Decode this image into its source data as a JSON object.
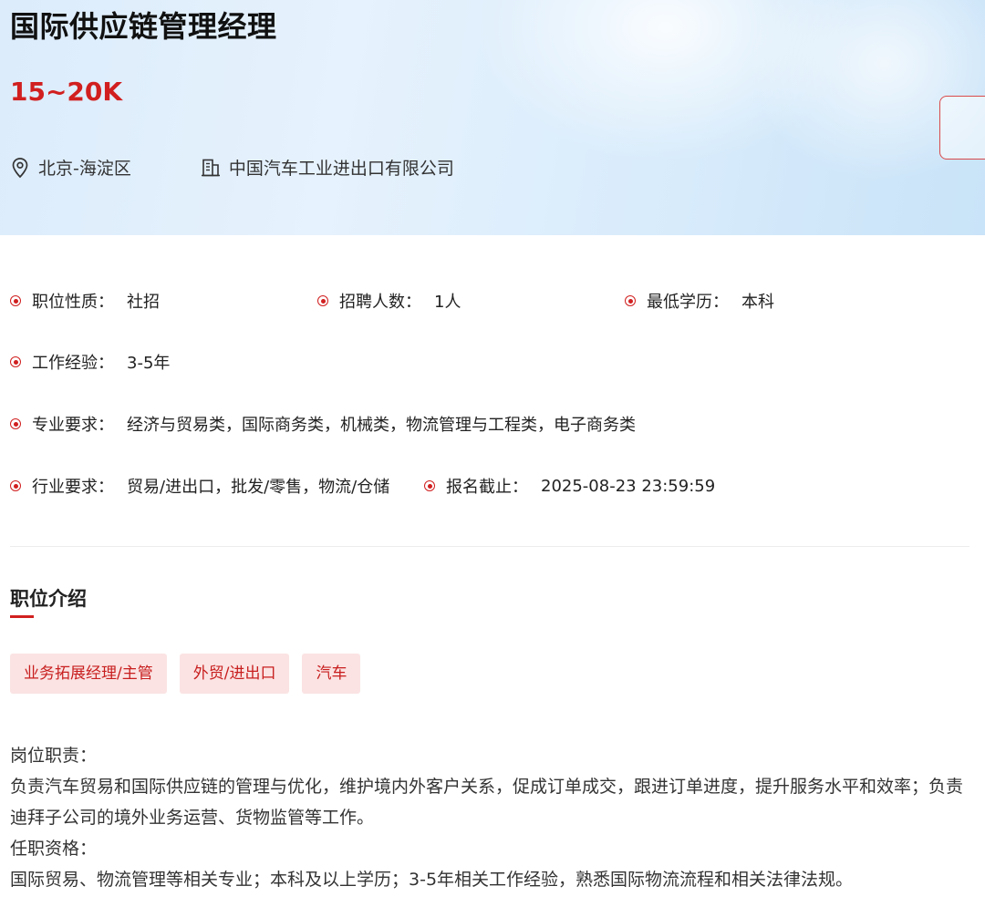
{
  "job": {
    "title": "国际供应链管理经理",
    "salary": "15~20K",
    "location": "北京-海淀区",
    "company": "中国汽车工业进出口有限公司"
  },
  "info": {
    "nature_label": "职位性质：",
    "nature_value": "社招",
    "headcount_label": "招聘人数：",
    "headcount_value": "1人",
    "education_label": "最低学历：",
    "education_value": "本科",
    "experience_label": "工作经验：",
    "experience_value": "3-5年",
    "major_label": "专业要求：",
    "major_value": "经济与贸易类，国际商务类，机械类，物流管理与工程类，电子商务类",
    "industry_label": "行业要求：",
    "industry_value": "贸易/进出口，批发/零售，物流/仓储",
    "deadline_label": "报名截止：",
    "deadline_value": "2025-08-23 23:59:59"
  },
  "section": {
    "title": "职位介绍"
  },
  "tags": [
    "业务拓展经理/主管",
    "外贸/进出口",
    "汽车"
  ],
  "description": {
    "duty_heading": "岗位职责：",
    "duty_text": "负责汽车贸易和国际供应链的管理与优化，维护境内外客户关系，促成订单成交，跟进订单进度，提升服务水平和效率；负责迪拜子公司的境外业务运营、货物监管等工作。",
    "req_heading": "任职资格：",
    "req_text": "国际贸易、物流管理等相关专业；本科及以上学历；3-5年相关工作经验，熟悉国际物流流程和相关法律法规。"
  },
  "icons": {
    "location": "location-pin-icon",
    "company": "building-icon",
    "bullet": "radio-dot-icon"
  },
  "colors": {
    "accent": "#d11f1f",
    "tag_bg": "#fbe3e3",
    "hero_bg": "#dcecfb"
  }
}
